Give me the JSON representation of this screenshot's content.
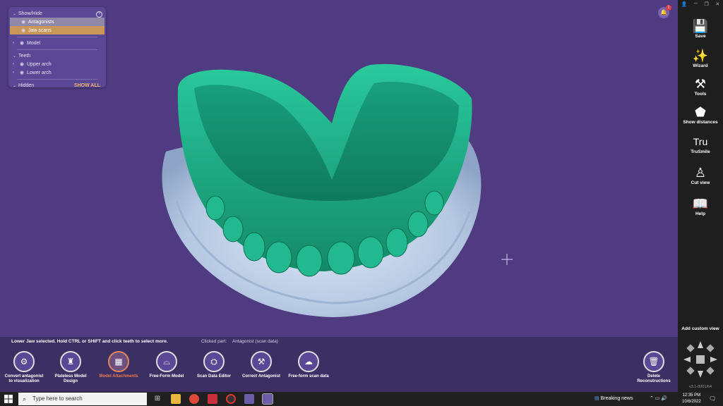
{
  "panel": {
    "show_hide": "Show/Hide",
    "antagonists": "Antagonists",
    "jaw_scans": "Jaw scans",
    "model": "Model",
    "teeth": "Teeth",
    "upper_arch": "Upper arch",
    "lower_arch": "Lower arch",
    "hidden": "Hidden",
    "show_all": "SHOW ALL"
  },
  "notification": {
    "count": "1"
  },
  "sidebar": {
    "save": "Save",
    "wizard": "Wizard",
    "tools": "Tools",
    "show_distances": "Show distances",
    "trusmile": "TruSmile",
    "trusmile_icon": "Tru",
    "cut_view": "Cut view",
    "help": "Help",
    "add_custom_view": "Add custom view",
    "version": "v3.1-8201/64"
  },
  "bottom": {
    "status": "Lower Jaw selected. Hold CTRL or SHIFT and click teeth to select more.",
    "clicked_label": "Clicked part:",
    "clicked_value": "Antagonist (scan data)",
    "tools": [
      {
        "label1": "Convert antagonist",
        "label2": "to visualization"
      },
      {
        "label1": "Plateless Model",
        "label2": "Design"
      },
      {
        "label1": "Model Attachments",
        "label2": ""
      },
      {
        "label1": "Free-Form Model",
        "label2": ""
      },
      {
        "label1": "Scan Data Editor",
        "label2": ""
      },
      {
        "label1": "Correct Antagonist",
        "label2": ""
      },
      {
        "label1": "Free-form scan data",
        "label2": ""
      }
    ],
    "delete": {
      "label1": "Delete",
      "label2": "Reconstructions"
    }
  },
  "taskbar": {
    "search_placeholder": "Type here to search",
    "news": "Breaking news",
    "time": "12:35 PM",
    "date": "10/6/2022"
  },
  "colors": {
    "viewport_bg": "#4e3b80",
    "model_green": "#1fae86",
    "model_blue": "#c3d4ea",
    "accent_orange": "#e0855a"
  }
}
